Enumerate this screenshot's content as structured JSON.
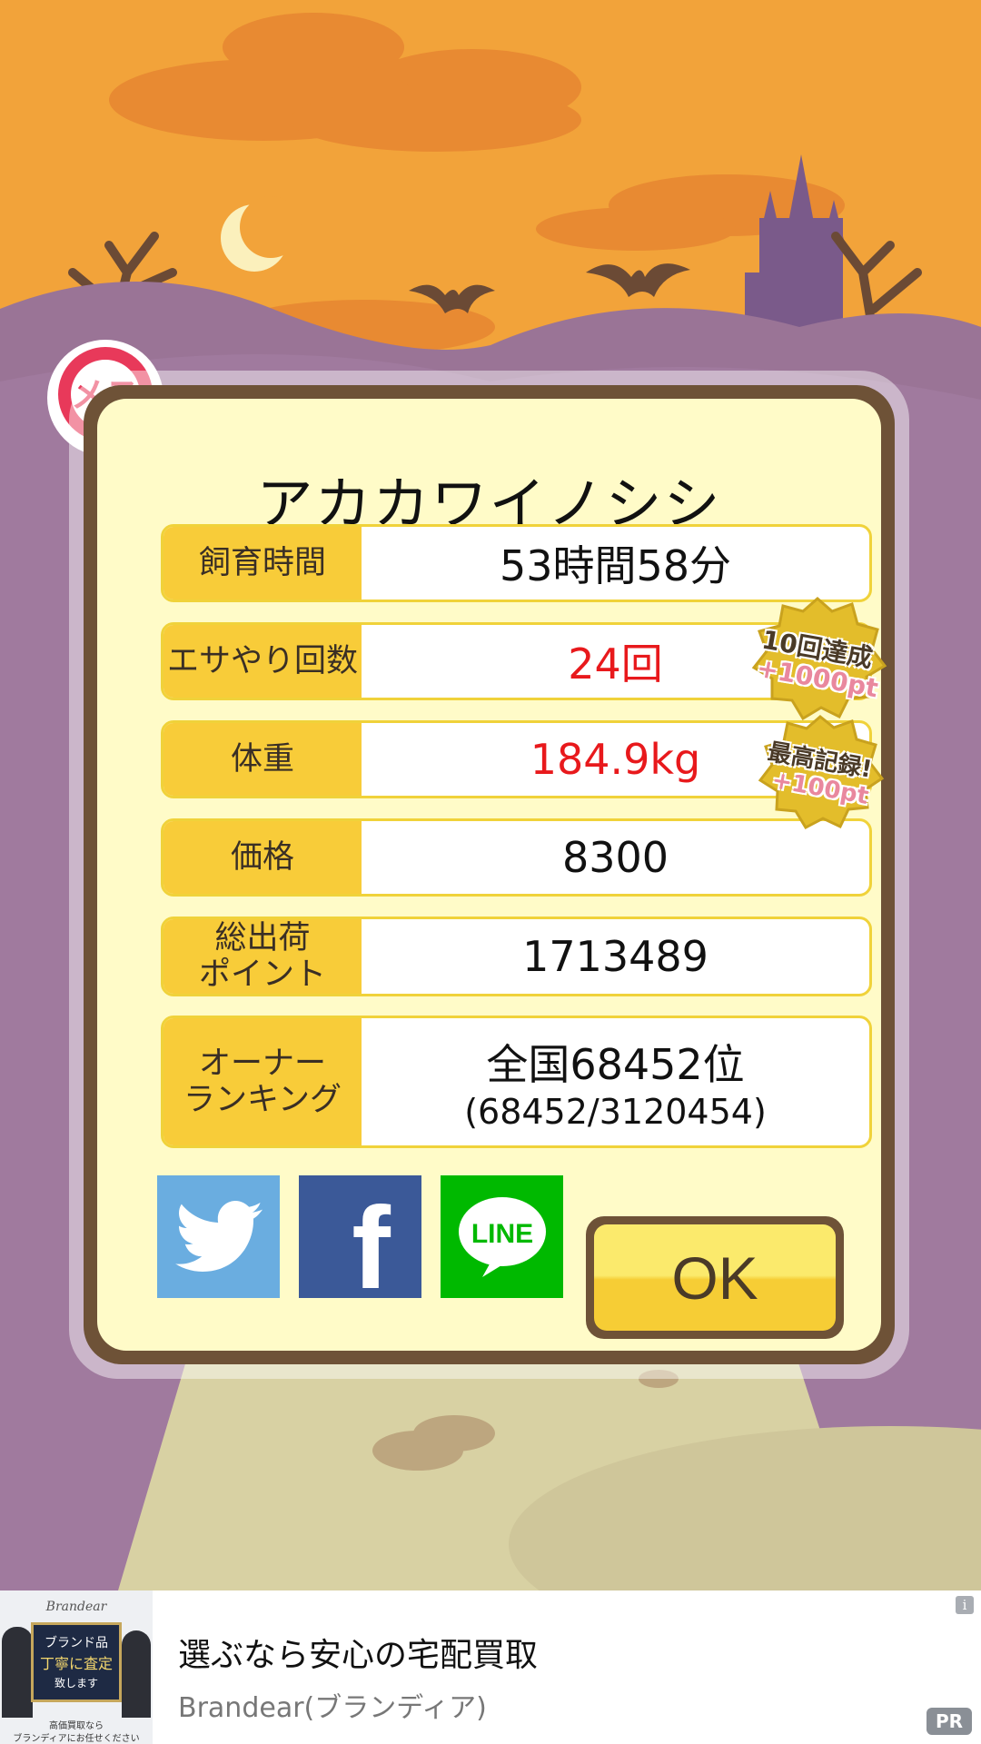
{
  "animal": {
    "name": "アカカワイノシシ",
    "sex_label": "メス"
  },
  "stats": [
    {
      "label": "飼育時間",
      "value": "53時間58分",
      "highlight": false
    },
    {
      "label": "エサやり回数",
      "value": "24回",
      "highlight": true
    },
    {
      "label": "体重",
      "value": "184.9kg",
      "highlight": true
    },
    {
      "label": "価格",
      "value": "8300",
      "highlight": false
    },
    {
      "label": "総出荷\nポイント",
      "value": "1713489",
      "highlight": false
    }
  ],
  "ranking": {
    "label": "オーナー\nランキング",
    "value": "全国68452位",
    "detail": "(68452/3120454)"
  },
  "badges": [
    {
      "line1": "10回達成",
      "line2": "+1000pt"
    },
    {
      "line1": "最高記録!",
      "line2": "+100pt"
    }
  ],
  "buttons": {
    "twitter_icon": "twitter-bird-icon",
    "facebook_label": "f",
    "line_label": "LINE",
    "ok_label": "OK"
  },
  "ad": {
    "image_text_brand": "Brandear",
    "image_text_line1": "ブランド品",
    "image_text_line2": "丁寧に査定",
    "image_text_line3": "致します",
    "image_text_bottom1": "高価買取なら",
    "image_text_bottom2": "ブランディアにお任せください",
    "title": "選ぶなら安心の宅配買取",
    "subtitle": "Brandear(ブランディア)",
    "pr_label": "PR",
    "info_label": "i"
  },
  "colors": {
    "sky": "#f2a33a",
    "card_bg": "#fffbc8",
    "label_bg": "#f8cc39",
    "highlight_text": "#e8191c",
    "twitter": "#6aade0",
    "facebook": "#3b5998",
    "line": "#00b900"
  }
}
